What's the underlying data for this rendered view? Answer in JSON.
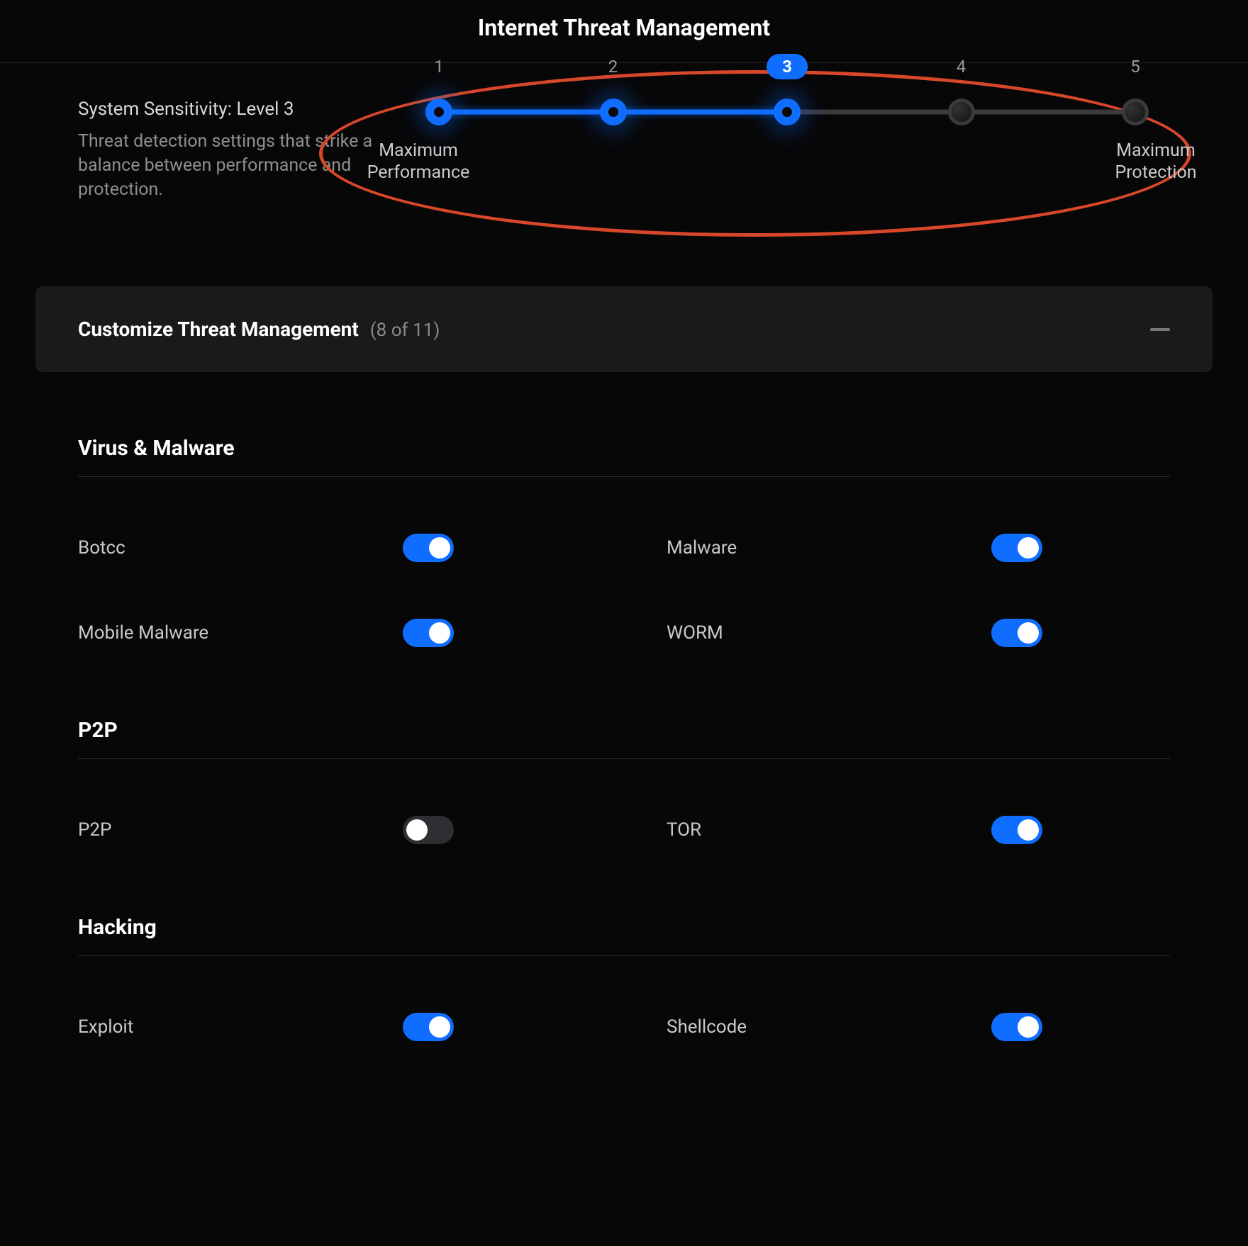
{
  "page": {
    "title": "Internet Threat Management"
  },
  "sensitivity": {
    "title": "System Sensitivity: Level 3",
    "description": "Threat detection settings that strike a balance between performance and protection.",
    "active_level": 3,
    "levels": [
      "1",
      "2",
      "3",
      "4",
      "5"
    ],
    "min_label": "Maximum Performance",
    "max_label": "Maximum Protection"
  },
  "customize": {
    "title": "Customize Threat Management",
    "count_label": "(8 of 11)",
    "active_count": 8,
    "total_count": 11,
    "expanded": true
  },
  "sections": [
    {
      "title": "Virus & Malware",
      "items": [
        {
          "label": "Botcc",
          "enabled": true
        },
        {
          "label": "Malware",
          "enabled": true
        },
        {
          "label": "Mobile Malware",
          "enabled": true
        },
        {
          "label": "WORM",
          "enabled": true
        }
      ]
    },
    {
      "title": "P2P",
      "items": [
        {
          "label": "P2P",
          "enabled": false
        },
        {
          "label": "TOR",
          "enabled": true
        }
      ]
    },
    {
      "title": "Hacking",
      "items": [
        {
          "label": "Exploit",
          "enabled": true
        },
        {
          "label": "Shellcode",
          "enabled": true
        }
      ]
    }
  ],
  "colors": {
    "accent": "#0f6dff",
    "annotation": "#d9472b",
    "background": "#070707",
    "card": "#1a1a1a"
  }
}
